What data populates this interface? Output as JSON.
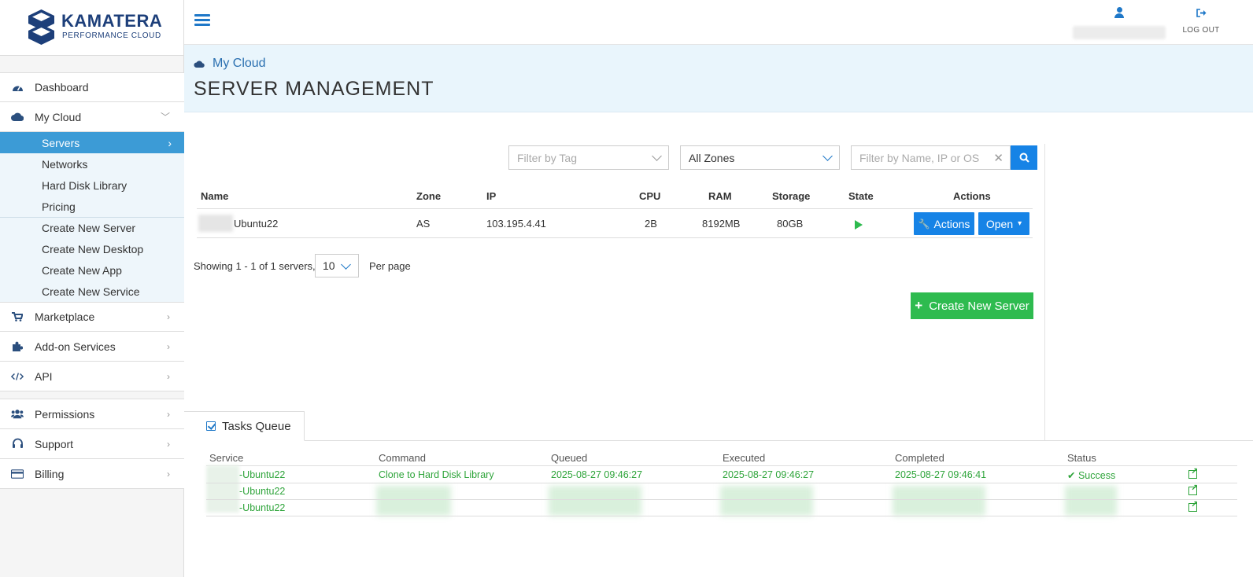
{
  "brand": {
    "title": "KAMATERA",
    "subtitle": "PERFORMANCE CLOUD"
  },
  "header": {
    "logout": "LOG OUT"
  },
  "sidebar": {
    "items": [
      {
        "label": "Dashboard",
        "icon": "dashboard-icon"
      },
      {
        "label": "My Cloud",
        "icon": "cloud-icon"
      }
    ],
    "sub_items": [
      {
        "label": "Servers"
      },
      {
        "label": "Networks"
      },
      {
        "label": "Hard Disk Library"
      },
      {
        "label": "Pricing"
      },
      {
        "label": "Create New Server"
      },
      {
        "label": "Create New Desktop"
      },
      {
        "label": "Create New App"
      },
      {
        "label": "Create New Service"
      }
    ],
    "more_items": [
      {
        "label": "Marketplace",
        "icon": "cart-icon"
      },
      {
        "label": "Add-on Services",
        "icon": "puzzle-icon"
      },
      {
        "label": "API",
        "icon": "code-icon"
      }
    ],
    "bottom_items": [
      {
        "label": "Permissions",
        "icon": "users-icon"
      },
      {
        "label": "Support",
        "icon": "headset-icon"
      },
      {
        "label": "Billing",
        "icon": "credit-card-icon"
      }
    ]
  },
  "page": {
    "breadcrumb": "My Cloud",
    "title": "SERVER MANAGEMENT"
  },
  "filters": {
    "tag_placeholder": "Filter by Tag",
    "zone_value": "All Zones",
    "search_placeholder": "Filter by Name, IP or OS"
  },
  "servers_table": {
    "columns": [
      "Name",
      "Zone",
      "IP",
      "CPU",
      "RAM",
      "Storage",
      "State",
      "Actions"
    ],
    "rows": [
      {
        "name": "Ubuntu22",
        "zone": "AS",
        "ip": "103.195.4.41",
        "cpu": "2B",
        "ram": "8192MB",
        "storage": "80GB",
        "state": "running"
      }
    ],
    "actions_label": "Actions",
    "open_label": "Open"
  },
  "pagination": {
    "showing": "Showing 1 - 1 of 1 servers,",
    "per_page_value": "10",
    "per_page_label": "Per page"
  },
  "create_button": "Create New Server",
  "tasks_queue": {
    "tab_label": "Tasks Queue",
    "columns": [
      "Service",
      "Command",
      "Queued",
      "Executed",
      "Completed",
      "Status"
    ],
    "rows": [
      {
        "service": "-Ubuntu22",
        "command": "Clone to Hard Disk Library",
        "queued": "2025-08-27 09:46:27",
        "executed": "2025-08-27 09:46:27",
        "completed": "2025-08-27 09:46:41",
        "status": "Success"
      },
      {
        "service": "-Ubuntu22"
      },
      {
        "service": "-Ubuntu22"
      }
    ]
  },
  "colors": {
    "accent": "#1683e6",
    "active_nav": "#3c9bd6",
    "success": "#2ebb4f",
    "brand": "#1d3f7a"
  }
}
